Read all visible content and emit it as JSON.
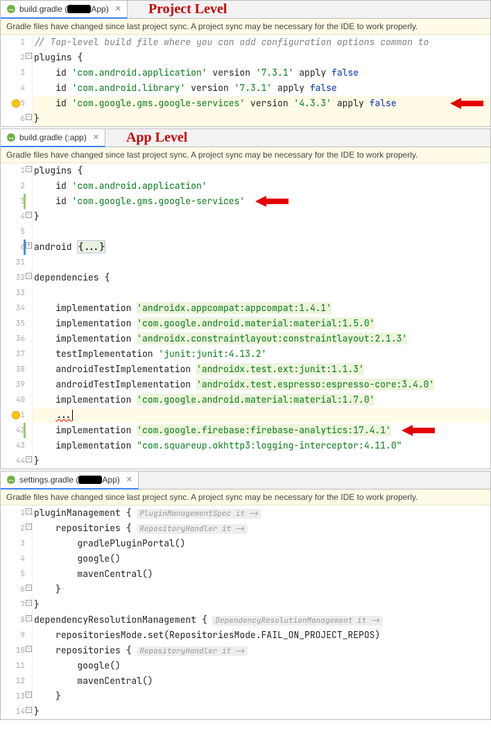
{
  "panel1": {
    "tabName": "build.gradle (",
    "tabNameSuffix": "App)",
    "labelRed": "Project Level",
    "sync": "Gradle files have changed since last project sync. A project sync may be necessary for the IDE to work properly.",
    "lines": [
      {
        "n": "1",
        "type": "comment",
        "text": "// Top-level build file where you can add configuration options common to"
      },
      {
        "n": "2",
        "type": "plugin-open",
        "kw": "plugins",
        "brace": "{"
      },
      {
        "n": "3",
        "type": "id",
        "id": "id",
        "str": "'com.android.application'",
        "ver": "version",
        "vstr": "'7.3.1'",
        "apply": "apply",
        "bool": "false"
      },
      {
        "n": "4",
        "type": "id",
        "id": "id",
        "str": "'com.android.library'",
        "ver": "version",
        "vstr": "'7.3.1'",
        "apply": "apply",
        "bool": "false"
      },
      {
        "n": "5",
        "type": "id",
        "id": "id",
        "str": "'com.google.gms.google-services'",
        "ver": "version",
        "vstr": "'4.3.3'",
        "apply": "apply",
        "bool": "false",
        "arrow": true,
        "bulb": true,
        "hl": true
      },
      {
        "n": "6",
        "type": "close",
        "brace": "}",
        "hl": true
      }
    ]
  },
  "panel2": {
    "tabName": "build.gradle (:app)",
    "labelRed": "App Level",
    "sync": "Gradle files have changed since last project sync. A project sync may be necessary for the IDE to work properly.",
    "lines": [
      {
        "n": "1",
        "indent": "",
        "parts": [
          {
            "t": "plugins ",
            "c": "plain"
          },
          {
            "t": "{",
            "c": "plain"
          }
        ],
        "fold": "-"
      },
      {
        "n": "2",
        "indent": "    ",
        "parts": [
          {
            "t": "id ",
            "c": "plain"
          },
          {
            "t": "'com.android.application'",
            "c": "str"
          }
        ]
      },
      {
        "n": "3",
        "indent": "    ",
        "parts": [
          {
            "t": "id ",
            "c": "plain"
          },
          {
            "t": "'com.google.gms.google-services'",
            "c": "str"
          }
        ],
        "arrow": true,
        "gb": "green"
      },
      {
        "n": "4",
        "indent": "",
        "parts": [
          {
            "t": "}",
            "c": "plain"
          }
        ],
        "fold": "-"
      },
      {
        "n": "5",
        "indent": "",
        "parts": []
      },
      {
        "n": "6",
        "indent": "",
        "parts": [
          {
            "t": "android ",
            "c": "plain"
          },
          {
            "t": "{...}",
            "c": "fold"
          }
        ],
        "fold": "+",
        "gb": "blue"
      },
      {
        "n": "31",
        "indent": "",
        "parts": []
      },
      {
        "n": "32",
        "indent": "",
        "parts": [
          {
            "t": "dependencies ",
            "c": "plain"
          },
          {
            "t": "{",
            "c": "plain"
          }
        ],
        "fold": "-"
      },
      {
        "n": "33",
        "indent": "",
        "parts": []
      },
      {
        "n": "34",
        "indent": "    ",
        "parts": [
          {
            "t": "implementation ",
            "c": "plain"
          },
          {
            "t": "'androidx.appcompat:appcompat:1.4.1'",
            "c": "str",
            "bg": true
          }
        ]
      },
      {
        "n": "35",
        "indent": "    ",
        "parts": [
          {
            "t": "implementation ",
            "c": "plain"
          },
          {
            "t": "'com.google.android.material:material:1.5.0'",
            "c": "str",
            "bg": true
          }
        ]
      },
      {
        "n": "36",
        "indent": "    ",
        "parts": [
          {
            "t": "implementation ",
            "c": "plain"
          },
          {
            "t": "'androidx.constraintlayout:constraintlayout:2.1.3'",
            "c": "str",
            "bg": true
          }
        ]
      },
      {
        "n": "37",
        "indent": "    ",
        "parts": [
          {
            "t": "testImplementation ",
            "c": "plain"
          },
          {
            "t": "'junit:junit:4.13.2'",
            "c": "str"
          }
        ]
      },
      {
        "n": "38",
        "indent": "    ",
        "parts": [
          {
            "t": "androidTestImplementation ",
            "c": "plain"
          },
          {
            "t": "'androidx.test.ext:junit:1.1.3'",
            "c": "str",
            "bg": true
          }
        ]
      },
      {
        "n": "39",
        "indent": "    ",
        "parts": [
          {
            "t": "androidTestImplementation ",
            "c": "plain"
          },
          {
            "t": "'androidx.test.espresso:espresso-core:3.4.0'",
            "c": "str",
            "bg": true
          }
        ]
      },
      {
        "n": "40",
        "indent": "    ",
        "parts": [
          {
            "t": "implementation ",
            "c": "plain"
          },
          {
            "t": "'com.google.android.material:material:1.7.0'",
            "c": "str",
            "bg": true
          }
        ]
      },
      {
        "n": "41",
        "indent": "    ",
        "parts": [
          {
            "t": "...",
            "c": "sq"
          }
        ],
        "bulb": true,
        "hl": true,
        "caret": true
      },
      {
        "n": "42",
        "indent": "    ",
        "parts": [
          {
            "t": "implementation ",
            "c": "plain"
          },
          {
            "t": "'com.google.firebase:firebase-analytics:17.4.1'",
            "c": "str",
            "bg": true
          }
        ],
        "arrow": true,
        "gb": "green"
      },
      {
        "n": "43",
        "indent": "    ",
        "parts": [
          {
            "t": "implementation ",
            "c": "plain"
          },
          {
            "t": "\"com.squareup.okhttp3:logging-interceptor:4.11.0\"",
            "c": "str"
          }
        ]
      },
      {
        "n": "44",
        "indent": "",
        "parts": [
          {
            "t": "}",
            "c": "plain"
          }
        ],
        "fold": "-"
      }
    ]
  },
  "panel3": {
    "tabName": "settings.gradle (",
    "tabNameSuffix": "App)",
    "sync": "Gradle files have changed since last project sync. A project sync may be necessary for the IDE to work properly.",
    "lines": [
      {
        "n": "1",
        "indent": "",
        "parts": [
          {
            "t": "pluginManagement ",
            "c": "plain"
          },
          {
            "t": "{ ",
            "c": "plain"
          },
          {
            "t": "PluginManagementSpec it ->",
            "c": "hint"
          }
        ],
        "fold": "-"
      },
      {
        "n": "2",
        "indent": "    ",
        "parts": [
          {
            "t": "repositories ",
            "c": "plain"
          },
          {
            "t": "{ ",
            "c": "plain"
          },
          {
            "t": "RepositoryHandler it ->",
            "c": "hint"
          }
        ],
        "fold": "-"
      },
      {
        "n": "3",
        "indent": "        ",
        "parts": [
          {
            "t": "gradlePluginPortal()",
            "c": "plain"
          }
        ]
      },
      {
        "n": "4",
        "indent": "        ",
        "parts": [
          {
            "t": "google()",
            "c": "plain"
          }
        ]
      },
      {
        "n": "5",
        "indent": "        ",
        "parts": [
          {
            "t": "mavenCentral()",
            "c": "plain"
          }
        ]
      },
      {
        "n": "6",
        "indent": "    ",
        "parts": [
          {
            "t": "}",
            "c": "plain"
          }
        ],
        "fold": "-"
      },
      {
        "n": "7",
        "indent": "",
        "parts": [
          {
            "t": "}",
            "c": "plain"
          }
        ],
        "fold": "-"
      },
      {
        "n": "8",
        "indent": "",
        "parts": [
          {
            "t": "dependencyResolutionManagement ",
            "c": "plain"
          },
          {
            "t": "{ ",
            "c": "plain"
          },
          {
            "t": "DependencyResolutionManagement it ->",
            "c": "hint"
          }
        ],
        "fold": "-"
      },
      {
        "n": "9",
        "indent": "    ",
        "parts": [
          {
            "t": "repositoriesMode.",
            "c": "plain"
          },
          {
            "t": "set",
            "c": "plain"
          },
          {
            "t": "(RepositoriesMode.",
            "c": "plain"
          },
          {
            "t": "FAIL_ON_PROJECT_REPOS",
            "c": "plain"
          },
          {
            "t": ")",
            "c": "plain"
          }
        ]
      },
      {
        "n": "10",
        "indent": "    ",
        "parts": [
          {
            "t": "repositories ",
            "c": "plain"
          },
          {
            "t": "{ ",
            "c": "plain"
          },
          {
            "t": "RepositoryHandler it ->",
            "c": "hint"
          }
        ],
        "fold": "-"
      },
      {
        "n": "11",
        "indent": "        ",
        "parts": [
          {
            "t": "google()",
            "c": "plain"
          }
        ]
      },
      {
        "n": "12",
        "indent": "        ",
        "parts": [
          {
            "t": "mavenCentral()",
            "c": "plain"
          }
        ]
      },
      {
        "n": "13",
        "indent": "    ",
        "parts": [
          {
            "t": "}",
            "c": "plain"
          }
        ],
        "fold": "-"
      },
      {
        "n": "14",
        "indent": "",
        "parts": [
          {
            "t": "}",
            "c": "plain"
          }
        ],
        "fold": "-"
      }
    ]
  }
}
